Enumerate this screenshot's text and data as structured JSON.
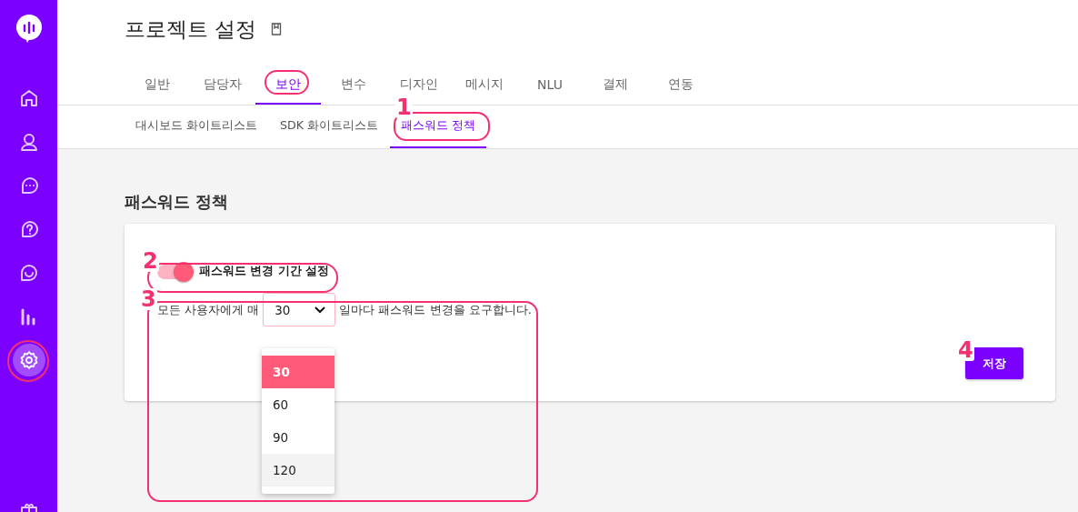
{
  "sidebar": {
    "items": [
      {
        "kind": "logo",
        "selected": false
      },
      {
        "kind": "home",
        "selected": false
      },
      {
        "kind": "user",
        "selected": false
      },
      {
        "kind": "chat",
        "selected": false
      },
      {
        "kind": "help",
        "selected": false
      },
      {
        "kind": "smile",
        "selected": false
      },
      {
        "kind": "chart",
        "selected": false
      },
      {
        "kind": "settings",
        "selected": true
      },
      {
        "kind": "gift",
        "selected": false
      }
    ]
  },
  "header": {
    "title": "프로젝트 설정",
    "tabs": [
      {
        "label": "일반",
        "selected": false
      },
      {
        "label": "담당자",
        "selected": false
      },
      {
        "label": "보안",
        "selected": true
      },
      {
        "label": "변수",
        "selected": false
      },
      {
        "label": "디자인",
        "selected": false
      },
      {
        "label": "메시지",
        "selected": false
      },
      {
        "label": "NLU",
        "selected": false
      },
      {
        "label": "결제",
        "selected": false
      },
      {
        "label": "연동",
        "selected": false
      }
    ]
  },
  "subtabs": [
    {
      "label": "대시보드 화이트리스트",
      "selected": false
    },
    {
      "label": "SDK 화이트리스트",
      "selected": false
    },
    {
      "label": "패스워드 정책",
      "selected": true
    }
  ],
  "section_title": "패스워드 정책",
  "card": {
    "toggle": {
      "label": "패스워드 변경 기간 설정",
      "on": true
    },
    "sentence_before": "모든 사용자에게 매",
    "sentence_after": "일마다 패스워드 변경을 요구합니다.",
    "select": {
      "value": "30",
      "expanded": true,
      "options": [
        {
          "label": "30",
          "selected": true,
          "hovered": false
        },
        {
          "label": "60",
          "selected": false,
          "hovered": false
        },
        {
          "label": "90",
          "selected": false,
          "hovered": false
        },
        {
          "label": "120",
          "selected": false,
          "hovered": true
        }
      ]
    },
    "save_button": "저장"
  },
  "annotations": [
    {
      "kind": "ring"
    },
    {
      "kind": "circle"
    },
    {
      "kind": "ring",
      "number": "1"
    },
    {
      "kind": "ring",
      "number": "2"
    },
    {
      "kind": "ring",
      "number": "3"
    },
    {
      "kind": "label",
      "number": "4"
    }
  ]
}
